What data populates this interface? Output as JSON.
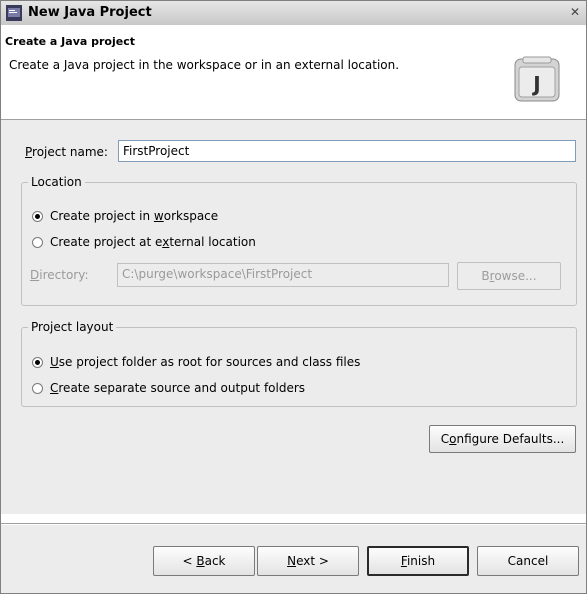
{
  "window": {
    "title": "New Java Project",
    "close_glyph": "✕"
  },
  "banner": {
    "title": "Create a Java project",
    "description": "Create a Java project in the workspace or in an external location.",
    "icon": "java-project-icon",
    "icon_letter": "J"
  },
  "project_name": {
    "label_mnemonic": "P",
    "label_rest": "roject name:",
    "value": "FirstProject"
  },
  "location": {
    "legend": "Location",
    "option_workspace": {
      "pre": "Create project in ",
      "mnemonic": "w",
      "post": "orkspace",
      "selected": true
    },
    "option_external": {
      "pre": "Create project at e",
      "mnemonic": "x",
      "post": "ternal location",
      "selected": false
    },
    "directory_label_mnemonic": "D",
    "directory_label_rest": "irectory:",
    "directory_value": "C:\\purge\\workspace\\FirstProject",
    "browse": {
      "pre": "B",
      "mnemonic": "r",
      "post": "owse..."
    }
  },
  "layout": {
    "legend": "Project layout",
    "option_single": {
      "mnemonic": "U",
      "post": "se project folder as root for sources and class files",
      "selected": true
    },
    "option_separate": {
      "mnemonic": "C",
      "post": "reate separate source and output folders",
      "selected": false
    }
  },
  "configure_defaults": {
    "pre": "C",
    "mnemonic": "o",
    "post": "nfigure Defaults..."
  },
  "footer": {
    "back": {
      "pre": "< ",
      "mnemonic": "B",
      "post": "ack"
    },
    "next": {
      "mnemonic": "N",
      "post": "ext >"
    },
    "finish": {
      "mnemonic": "F",
      "post": "inish"
    },
    "cancel": "Cancel"
  }
}
